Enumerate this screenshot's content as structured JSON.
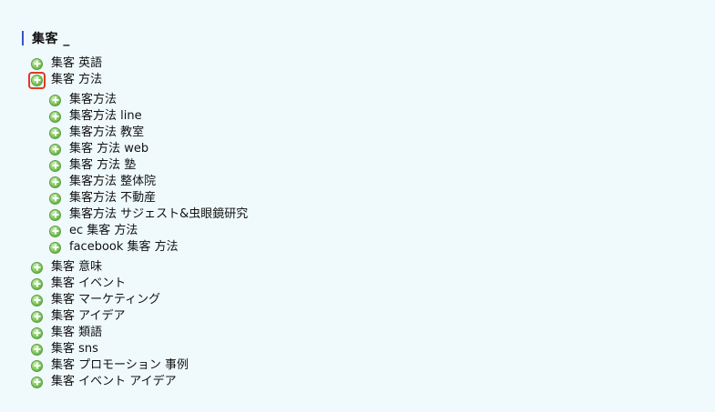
{
  "heading": {
    "title": "集客 _"
  },
  "tree": {
    "top_items_before": [
      {
        "label": "集客 英語"
      }
    ],
    "expanded_item": {
      "label": "集客 方法",
      "children": [
        {
          "label": "集客方法"
        },
        {
          "label": "集客方法 line"
        },
        {
          "label": "集客方法 教室"
        },
        {
          "label": "集客 方法 web"
        },
        {
          "label": "集客 方法 塾"
        },
        {
          "label": "集客方法 整体院"
        },
        {
          "label": "集客方法 不動産"
        },
        {
          "label": "集客方法 サジェスト&虫眼鏡研究"
        },
        {
          "label": "ec 集客 方法"
        },
        {
          "label": "facebook 集客 方法"
        }
      ]
    },
    "top_items_after": [
      {
        "label": "集客 意味"
      },
      {
        "label": "集客 イベント"
      },
      {
        "label": "集客 マーケティング"
      },
      {
        "label": "集客 アイデア"
      },
      {
        "label": "集客 類語"
      },
      {
        "label": "集客 sns"
      },
      {
        "label": "集客 プロモーション 事例"
      },
      {
        "label": "集客 イベント アイデア"
      }
    ]
  },
  "colors": {
    "background": "#f0fafd",
    "heading_bar": "#3355cc",
    "expand_icon": "#7fc85a",
    "selection_outline": "#e23a1f"
  },
  "icons": {
    "expand": "plus-circle-icon"
  }
}
